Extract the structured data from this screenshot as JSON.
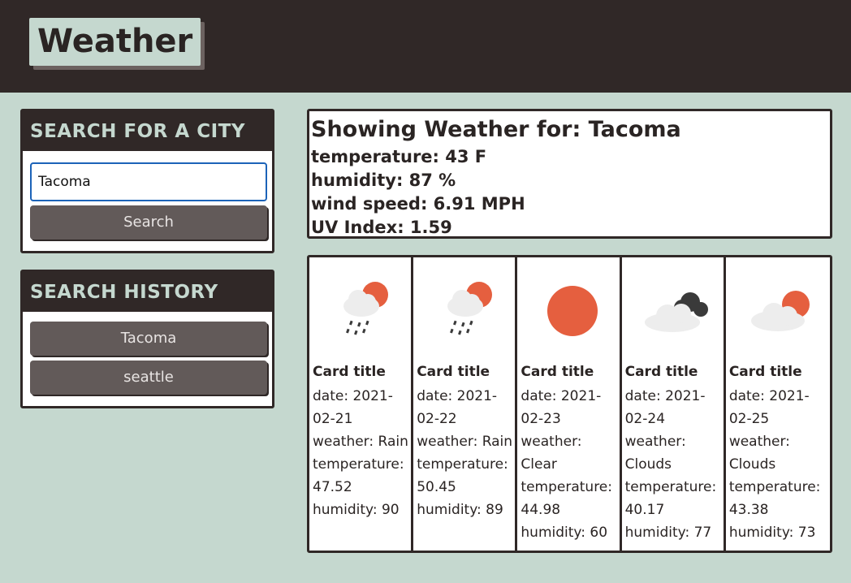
{
  "header": {
    "brand": "Weather"
  },
  "search": {
    "heading": "SEARCH FOR A CITY",
    "value": "Tacoma",
    "button_label": "Search"
  },
  "history": {
    "heading": "SEARCH HISTORY",
    "items": [
      {
        "label": "Tacoma"
      },
      {
        "label": "seattle"
      }
    ]
  },
  "current": {
    "title": "Showing Weather for: Tacoma",
    "temperature": "temperature: 43 F",
    "humidity": "humidity: 87 %",
    "wind": "wind speed: 6.91 MPH",
    "uv": "UV Index: 1.59"
  },
  "forecast": [
    {
      "icon": "rain-sun-icon",
      "title": "Card title",
      "date": "date: 2021-02-21",
      "weather": "weather: Rain",
      "temperature": "temperature: 47.52",
      "humidity": "humidity: 90"
    },
    {
      "icon": "rain-sun-icon",
      "title": "Card title",
      "date": "date: 2021-02-22",
      "weather": "weather: Rain",
      "temperature": "temperature: 50.45",
      "humidity": "humidity: 89"
    },
    {
      "icon": "sun-icon",
      "title": "Card title",
      "date": "date: 2021-02-23",
      "weather": "weather: Clear",
      "temperature": "temperature: 44.98",
      "humidity": "humidity: 60"
    },
    {
      "icon": "clouds-icon",
      "title": "Card title",
      "date": "date: 2021-02-24",
      "weather": "weather: Clouds",
      "temperature": "temperature: 40.17",
      "humidity": "humidity: 77"
    },
    {
      "icon": "cloud-sun-icon",
      "title": "Card title",
      "date": "date: 2021-02-25",
      "weather": "weather: Clouds",
      "temperature": "temperature: 43.38",
      "humidity": "humidity: 73"
    }
  ],
  "colors": {
    "background": "#c5d8cf",
    "header": "#302827",
    "button": "#625a59",
    "sun": "#e55f3f",
    "cloud": "#ededed",
    "dark_cloud": "#3a3a3a"
  }
}
